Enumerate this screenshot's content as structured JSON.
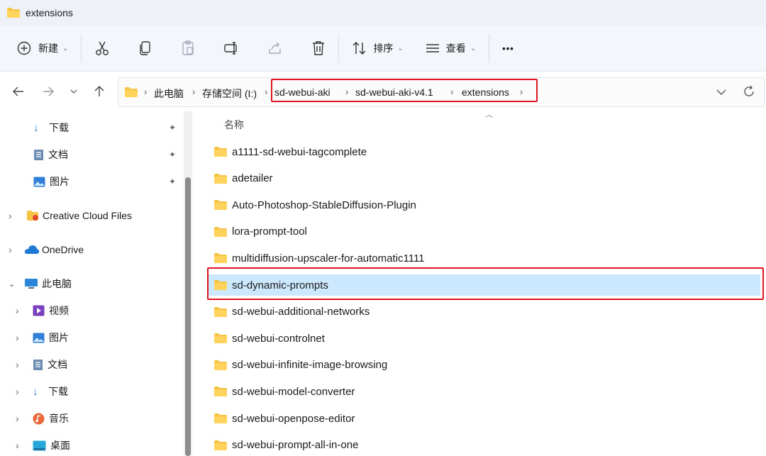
{
  "window": {
    "title": "extensions"
  },
  "toolbar": {
    "new_label": "新建",
    "sort_label": "排序",
    "view_label": "查看",
    "more_label": "•••"
  },
  "address": {
    "crumbs": [
      "此电脑",
      "存储空间 (I:)",
      "sd-webui-aki",
      "sd-webui-aki-v4.1",
      "extensions"
    ]
  },
  "sidebar": {
    "quick": [
      {
        "label": "下载",
        "icon": "download-icon",
        "pinned": true
      },
      {
        "label": "文档",
        "icon": "document-icon",
        "pinned": true
      },
      {
        "label": "图片",
        "icon": "picture-icon",
        "pinned": true
      }
    ],
    "roots": [
      {
        "label": "Creative Cloud Files",
        "icon": "creative-cloud-icon",
        "expanded": false
      },
      {
        "label": "OneDrive",
        "icon": "onedrive-cloud-icon",
        "expanded": false
      },
      {
        "label": "此电脑",
        "icon": "computer-icon",
        "expanded": true
      }
    ],
    "pc_children": [
      {
        "label": "视频",
        "icon": "video-icon"
      },
      {
        "label": "图片",
        "icon": "picture-icon"
      },
      {
        "label": "文档",
        "icon": "document-icon"
      },
      {
        "label": "下载",
        "icon": "download-icon"
      },
      {
        "label": "音乐",
        "icon": "music-icon"
      },
      {
        "label": "桌面",
        "icon": "desktop-icon"
      }
    ]
  },
  "list": {
    "column_name": "名称",
    "items": [
      "a1111-sd-webui-tagcomplete",
      "adetailer",
      "Auto-Photoshop-StableDiffusion-Plugin",
      "lora-prompt-tool",
      "multidiffusion-upscaler-for-automatic1111",
      "sd-dynamic-prompts",
      "sd-webui-additional-networks",
      "sd-webui-controlnet",
      "sd-webui-infinite-image-browsing",
      "sd-webui-model-converter",
      "sd-webui-openpose-editor",
      "sd-webui-prompt-all-in-one"
    ],
    "selected": "sd-dynamic-prompts"
  },
  "colors": {
    "accent_highlight": "#e0141e",
    "selection": "#cce8ff",
    "folder": "#f5c445"
  }
}
